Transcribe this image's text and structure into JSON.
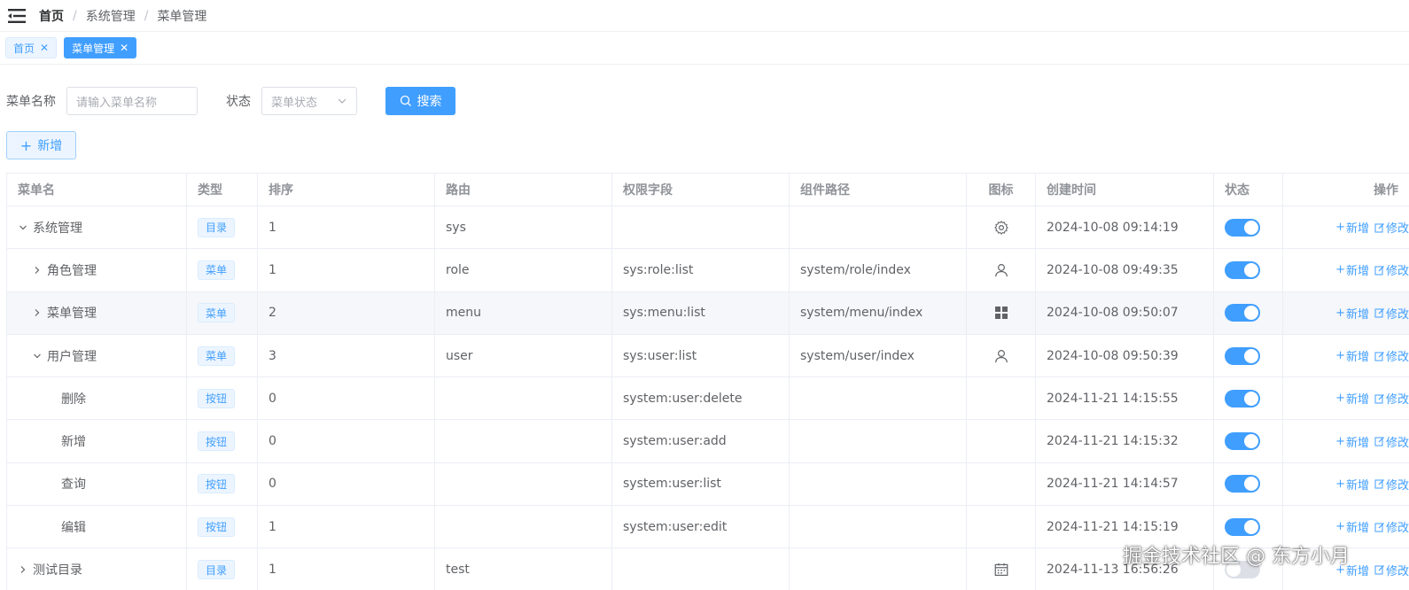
{
  "breadcrumb": [
    "首页",
    "系统管理",
    "菜单管理"
  ],
  "tabs": [
    {
      "label": "首页",
      "active": false
    },
    {
      "label": "菜单管理",
      "active": true
    }
  ],
  "search": {
    "name_label": "菜单名称",
    "name_placeholder": "请输入菜单名称",
    "status_label": "状态",
    "status_placeholder": "菜单状态",
    "search_button": "搜索"
  },
  "add_button": "新增",
  "table": {
    "headers": [
      "菜单名",
      "类型",
      "排序",
      "路由",
      "权限字段",
      "组件路径",
      "图标",
      "创建时间",
      "状态",
      "操作"
    ],
    "op_add": "新增",
    "op_edit": "修改",
    "rows": [
      {
        "name": "系统管理",
        "level": 0,
        "expand": "down",
        "type": "目录",
        "order": "1",
        "route": "sys",
        "perm": "",
        "component": "",
        "icon": "gear-icon",
        "created": "2024-10-08 09:14:19",
        "enabled": true
      },
      {
        "name": "角色管理",
        "level": 1,
        "expand": "right",
        "type": "菜单",
        "order": "1",
        "route": "role",
        "perm": "sys:role:list",
        "component": "system/role/index",
        "icon": "user-icon",
        "created": "2024-10-08 09:49:35",
        "enabled": true
      },
      {
        "name": "菜单管理",
        "level": 1,
        "expand": "right",
        "type": "菜单",
        "order": "2",
        "route": "menu",
        "perm": "sys:menu:list",
        "component": "system/menu/index",
        "icon": "grid-icon",
        "created": "2024-10-08 09:50:07",
        "enabled": true
      },
      {
        "name": "用户管理",
        "level": 1,
        "expand": "down",
        "type": "菜单",
        "order": "3",
        "route": "user",
        "perm": "sys:user:list",
        "component": "system/user/index",
        "icon": "user-icon",
        "created": "2024-10-08 09:50:39",
        "enabled": true
      },
      {
        "name": "删除",
        "level": 2,
        "expand": "",
        "type": "按钮",
        "order": "0",
        "route": "",
        "perm": "system:user:delete",
        "component": "",
        "icon": "",
        "created": "2024-11-21 14:15:55",
        "enabled": true
      },
      {
        "name": "新增",
        "level": 2,
        "expand": "",
        "type": "按钮",
        "order": "0",
        "route": "",
        "perm": "system:user:add",
        "component": "",
        "icon": "",
        "created": "2024-11-21 14:15:32",
        "enabled": true
      },
      {
        "name": "查询",
        "level": 2,
        "expand": "",
        "type": "按钮",
        "order": "0",
        "route": "",
        "perm": "system:user:list",
        "component": "",
        "icon": "",
        "created": "2024-11-21 14:14:57",
        "enabled": true
      },
      {
        "name": "编辑",
        "level": 2,
        "expand": "",
        "type": "按钮",
        "order": "1",
        "route": "",
        "perm": "system:user:edit",
        "component": "",
        "icon": "",
        "created": "2024-11-21 14:15:19",
        "enabled": true
      },
      {
        "name": "测试目录",
        "level": 0,
        "expand": "right",
        "type": "目录",
        "order": "1",
        "route": "test",
        "perm": "",
        "component": "",
        "icon": "calendar-icon",
        "created": "2024-11-13 16:56:26",
        "enabled": false
      }
    ]
  },
  "watermark": "掘金技术社区 @ 东方小月",
  "colors": {
    "primary": "#409eff",
    "border": "#ebeef5",
    "text": "#606266"
  }
}
